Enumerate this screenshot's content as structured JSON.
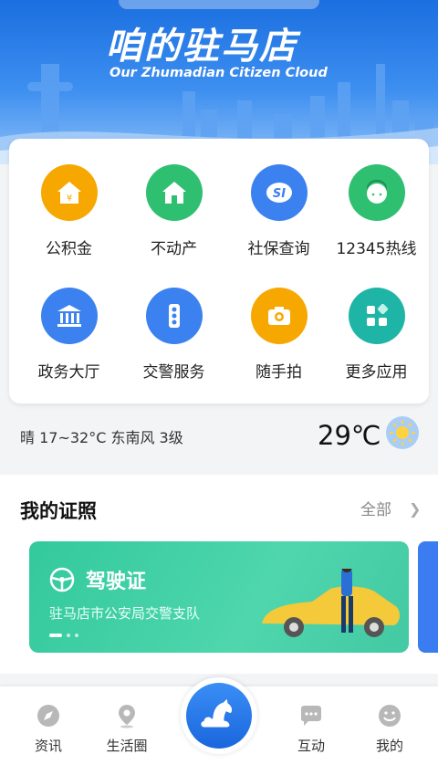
{
  "header": {
    "title": "咱的驻马店",
    "subtitle": "Our Zhumadian Citizen Cloud"
  },
  "services": [
    {
      "label": "公积金",
      "icon": "housing-fund-icon",
      "color": "#f7a800"
    },
    {
      "label": "不动产",
      "icon": "house-icon",
      "color": "#2fbf71"
    },
    {
      "label": "社保查询",
      "icon": "social-security-icon",
      "color": "#3b82f0"
    },
    {
      "label": "12345热线",
      "icon": "hotline-icon",
      "color": "#2fbf71"
    },
    {
      "label": "政务大厅",
      "icon": "government-hall-icon",
      "color": "#3b82f0"
    },
    {
      "label": "交警服务",
      "icon": "traffic-light-icon",
      "color": "#3b82f0"
    },
    {
      "label": "随手拍",
      "icon": "camera-icon",
      "color": "#f7a800"
    },
    {
      "label": "更多应用",
      "icon": "more-apps-icon",
      "color": "#1fb5a6"
    }
  ],
  "weather": {
    "desc": "晴  17~32°C  东南风 3级",
    "temp": "29℃",
    "icon": "sun-icon"
  },
  "license": {
    "title": "我的证照",
    "all_label": "全部",
    "card": {
      "name": "驾驶证",
      "org": "驻马店市公安局交警支队",
      "icon": "steering-wheel-icon"
    }
  },
  "nav": {
    "items": [
      {
        "label": "资讯",
        "icon": "compass-icon"
      },
      {
        "label": "生活圈",
        "icon": "location-icon"
      },
      {
        "label": "",
        "icon": "horse-cloud-logo"
      },
      {
        "label": "互动",
        "icon": "chat-icon"
      },
      {
        "label": "我的",
        "icon": "smile-icon"
      }
    ]
  },
  "colors": {
    "brand_blue": "#1b6fe0",
    "card_green": "#33c99d"
  }
}
